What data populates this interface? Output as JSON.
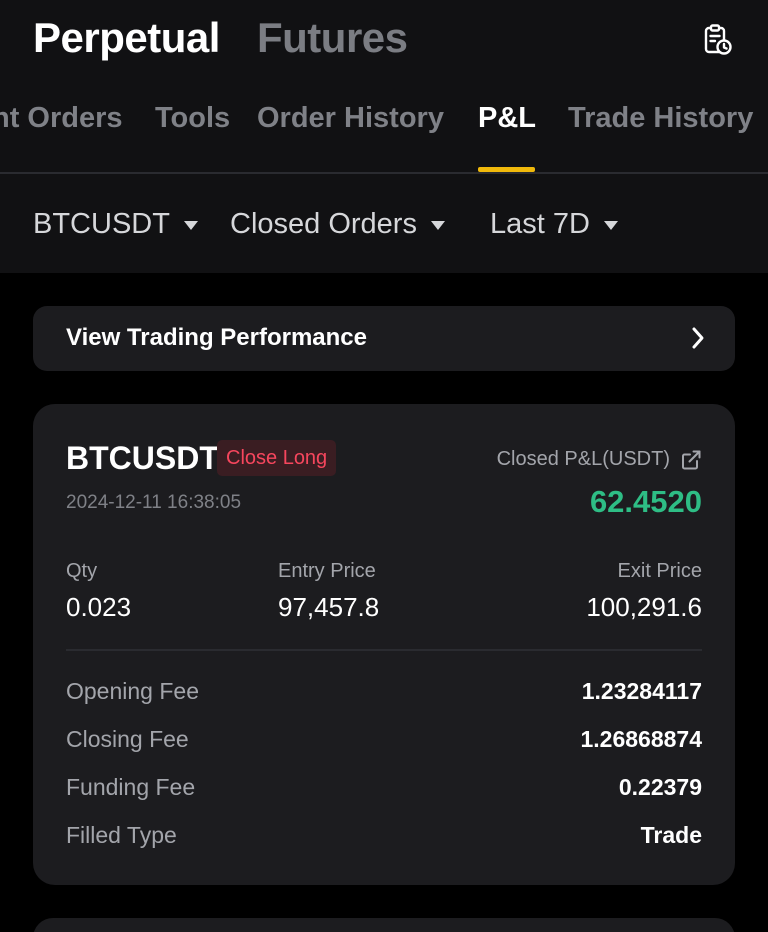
{
  "header": {
    "title": "Perpetual",
    "alt_title": "Futures",
    "icon": "order-clock-icon"
  },
  "tabs": [
    {
      "label": "nt Orders"
    },
    {
      "label": "Tools"
    },
    {
      "label": "Order History"
    },
    {
      "label": "P&L",
      "active": true
    },
    {
      "label": "Trade History"
    }
  ],
  "filters": {
    "symbol": "BTCUSDT",
    "order_type": "Closed Orders",
    "period": "Last 7D"
  },
  "performance": {
    "label": "View Trading Performance"
  },
  "position": {
    "symbol": "BTCUSDT",
    "side": "Close Long",
    "timestamp": "2024-12-11 16:38:05",
    "pnl_label": "Closed P&L(USDT)",
    "pnl_value": "62.4520",
    "qty_label": "Qty",
    "qty": "0.023",
    "entry_label": "Entry Price",
    "entry_price": "97,457.8",
    "exit_label": "Exit Price",
    "exit_price": "100,291.6",
    "fees": [
      {
        "label": "Opening Fee",
        "value": "1.23284117"
      },
      {
        "label": "Closing Fee",
        "value": "1.26868874"
      },
      {
        "label": "Funding Fee",
        "value": "0.22379"
      },
      {
        "label": "Filled Type",
        "value": "Trade"
      }
    ]
  },
  "colors": {
    "accent": "#f0b90b",
    "profit": "#2ebd85",
    "loss": "#f6465d",
    "card": "#1c1c1f"
  }
}
